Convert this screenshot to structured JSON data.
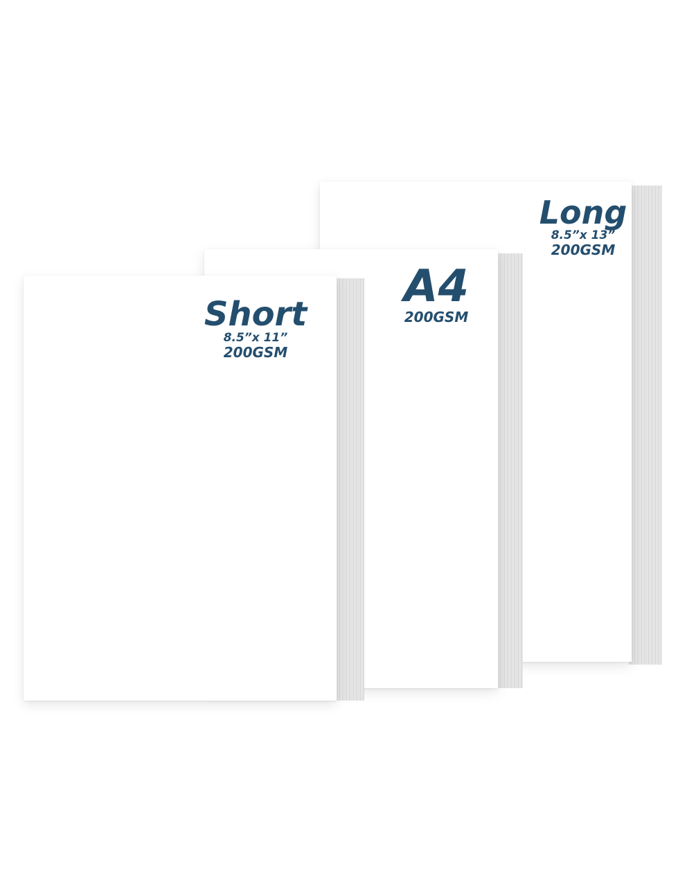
{
  "products": {
    "long": {
      "title": "Long",
      "dimensions": "8.5”x 13”",
      "weight": "200GSM"
    },
    "a4": {
      "title": "A4",
      "weight": "200GSM"
    },
    "short": {
      "title": "Short",
      "dimensions": "8.5”x 11”",
      "weight": "200GSM"
    }
  },
  "colors": {
    "label_text": "#244e6e",
    "sheet": "#ffffff",
    "paper_edge": "#d9d9d9",
    "background": "#ffffff"
  }
}
